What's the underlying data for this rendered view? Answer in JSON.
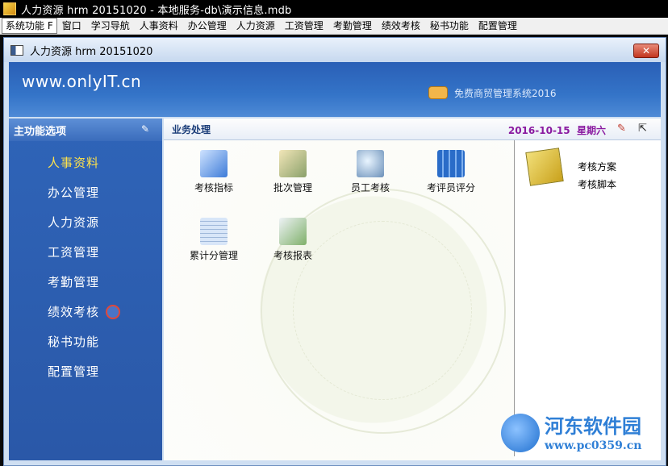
{
  "window": {
    "title": "人力资源 hrm 20151020 - 本地服务-db\\演示信息.mdb"
  },
  "menubar": {
    "items": [
      "系统功能 F",
      "窗口",
      "学习导航",
      "人事资料",
      "办公管理",
      "人力资源",
      "工资管理",
      "考勤管理",
      "绩效考核",
      "秘书功能",
      "配置管理"
    ]
  },
  "inner_window": {
    "title": "人力资源 hrm 20151020",
    "close_label": "✕"
  },
  "banner": {
    "site": "www.onlyIT.cn",
    "system_name": "免费商贸管理系统2016"
  },
  "sidebar": {
    "header": "主功能选项",
    "items": [
      "人事资料",
      "办公管理",
      "人力资源",
      "工资管理",
      "考勤管理",
      "绩效考核",
      "秘书功能",
      "配置管理"
    ]
  },
  "main": {
    "title": "业务处理",
    "date": "2016-10-15",
    "weekday": "星期六",
    "tiles": [
      "考核指标",
      "批次管理",
      "员工考核",
      "考评员评分",
      "累计分管理",
      "考核报表"
    ]
  },
  "right_panel": {
    "items": [
      "考核方案",
      "考核脚本"
    ]
  },
  "watermark": {
    "name": "河东软件园",
    "url": "www.pc0359.cn"
  },
  "colors": {
    "banner_blue": "#2a5fb6",
    "active_item": "#ffe24a",
    "date_color": "#8a1aa0"
  }
}
